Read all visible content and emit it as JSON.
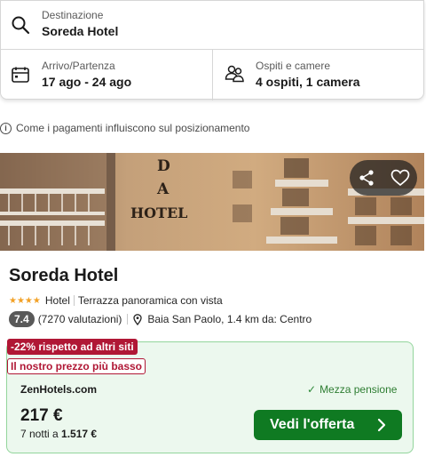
{
  "search": {
    "destination_label": "Destinazione",
    "destination_value": "Soreda Hotel",
    "dates_label": "Arrivo/Partenza",
    "dates_value": "17 ago - 24 ago",
    "guests_label": "Ospiti e camere",
    "guests_value": "4 ospiti, 1 camera"
  },
  "info": {
    "icon_glyph": "i",
    "text": "Come i pagamenti influiscono sul posizionamento"
  },
  "photo": {
    "sign_line1": "D",
    "sign_line2": "A",
    "sign_line3": "HOTEL"
  },
  "hotel": {
    "name": "Soreda Hotel",
    "stars": "★★★★",
    "type": "Hotel",
    "feature": "Terrazza panoramica con vista",
    "score": "7.4",
    "reviews": "(7270 valutazioni)",
    "location": "Baia San Paolo, 1.4 km da: Centro"
  },
  "deal": {
    "discount_badge": "-22% rispetto ad altri siti",
    "lowest_badge": "Il nostro prezzo più basso",
    "provider": "ZenHotels.com",
    "board_check": "✓",
    "board": "Mezza pensione",
    "price": "217 €",
    "nights_prefix": "7 notti a ",
    "nights_total": "1.517 €",
    "cta_label": "Vedi l'offerta"
  },
  "colors": {
    "brand_green": "#0f7a22",
    "badge_red": "#b01735",
    "deal_bg": "#ecf8ee",
    "star": "#f2a126"
  },
  "icons": [
    "search-icon",
    "calendar-icon",
    "guests-icon",
    "info-icon",
    "share-icon",
    "heart-icon",
    "location-pin-icon",
    "check-icon",
    "chevron-right-icon"
  ]
}
